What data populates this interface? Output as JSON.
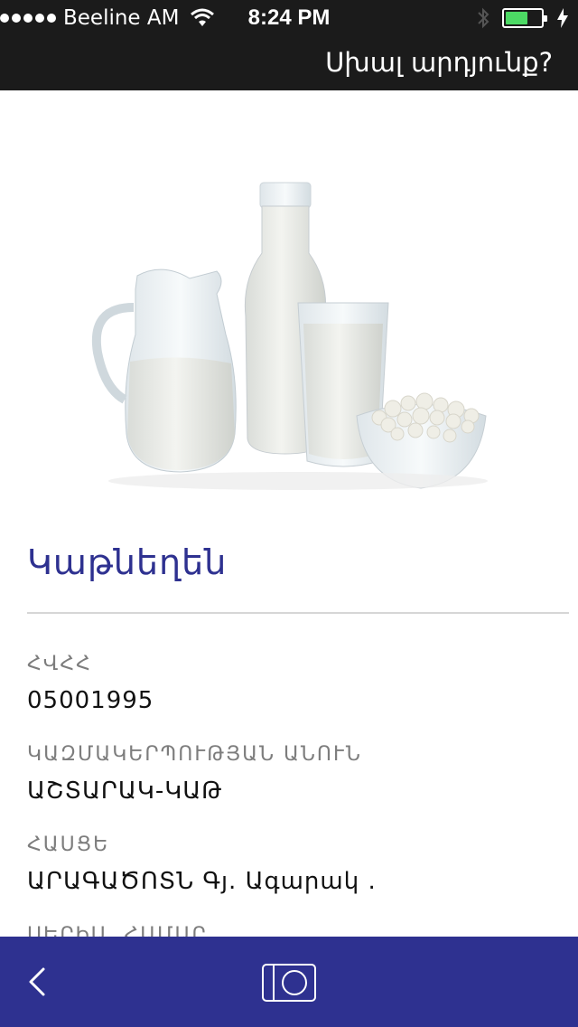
{
  "status_bar": {
    "carrier": "Beeline AM",
    "time": "8:24 PM",
    "battery_color": "#4cd964"
  },
  "header": {
    "action_label": "Սխալ արդյունք?"
  },
  "product": {
    "image_icon": "dairy-products-image",
    "name": "Կաթնեղեն"
  },
  "fields": [
    {
      "label": "ՀՎՀՀ",
      "value": "05001995"
    },
    {
      "label": "ԿԱԶՄԱԿԵՐՊՈՒԹՅԱՆ ԱՆՈՒՆ",
      "value": "ԱՇՏԱՐԱԿ-ԿԱԹ"
    },
    {
      "label": "ՀԱՍՑԵ",
      "value": "ԱՐԱԳԱԾՈՏՆ Գյ. Ագարակ ."
    },
    {
      "label": "ՍԵՐԻԱ, ՀԱՄԱՐ",
      "value": ""
    }
  ],
  "toolbar": {
    "back_icon": "chevron-left-icon",
    "camera_icon": "camera-icon"
  },
  "colors": {
    "accent": "#2e3190",
    "top_bar": "#1b1b1b"
  }
}
